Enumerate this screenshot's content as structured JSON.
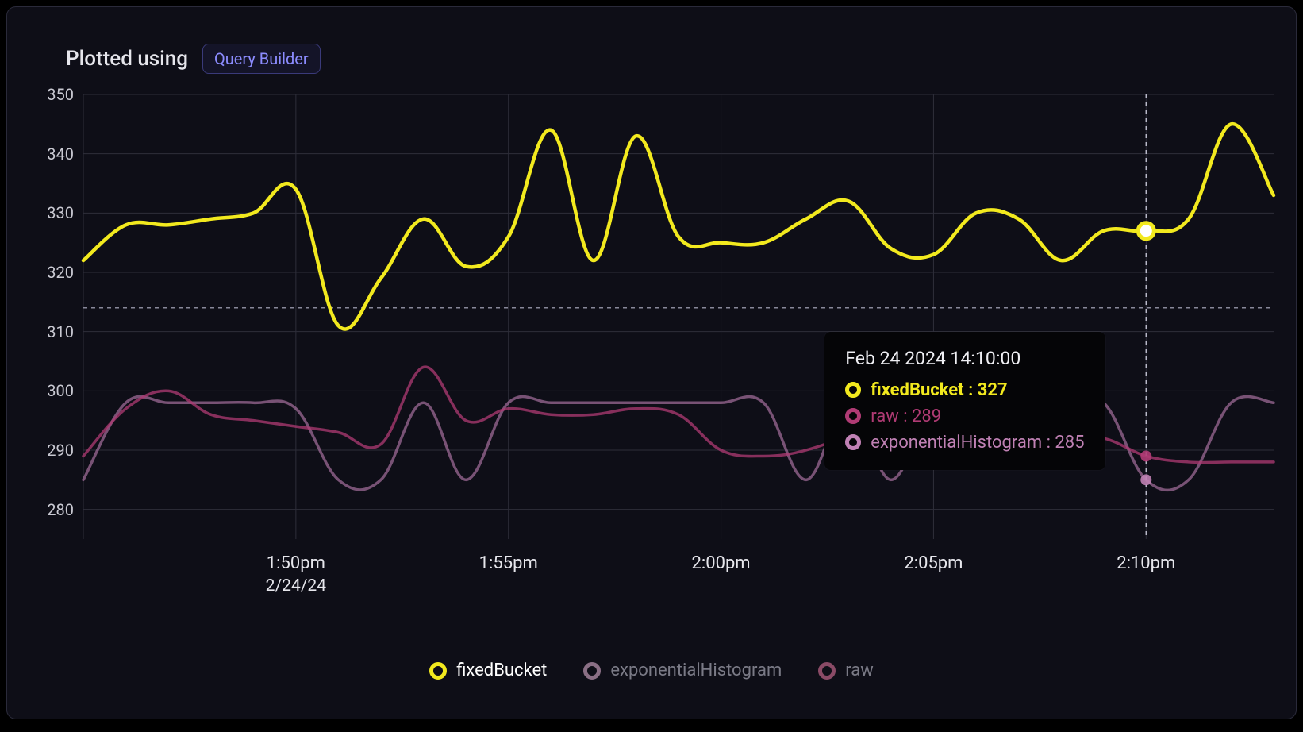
{
  "header": {
    "title": "Plotted using",
    "badge": "Query Builder"
  },
  "chart_data": {
    "type": "line",
    "ylim": [
      275,
      350
    ],
    "y_ticks": [
      280,
      290,
      300,
      310,
      320,
      330,
      340,
      350
    ],
    "x_ticks": [
      {
        "label": "1:50pm",
        "sub": "2/24/24",
        "idx": 5
      },
      {
        "label": "1:55pm",
        "sub": "",
        "idx": 10
      },
      {
        "label": "2:00pm",
        "sub": "",
        "idx": 15
      },
      {
        "label": "2:05pm",
        "sub": "",
        "idx": 20
      },
      {
        "label": "2:10pm",
        "sub": "",
        "idx": 25
      }
    ],
    "reference_line": 314,
    "hover_idx": 25,
    "series": [
      {
        "name": "fixedBucket",
        "color": "#f2e91e",
        "width": 4.5,
        "opacity": 1,
        "values": [
          322,
          328,
          328,
          329,
          330,
          334,
          311,
          319,
          329,
          321,
          326,
          344,
          322,
          343,
          326,
          325,
          325,
          329,
          332,
          324,
          323,
          330,
          329,
          322,
          327,
          327,
          329,
          345,
          333
        ]
      },
      {
        "name": "exponentialHistogram",
        "color": "#c081b4",
        "width": 3.5,
        "opacity": 0.6,
        "values": [
          285,
          298,
          298,
          298,
          298,
          297,
          285,
          285,
          298,
          285,
          298,
          298,
          298,
          298,
          298,
          298,
          298,
          285,
          298,
          285,
          298,
          298,
          298,
          298,
          298,
          285,
          285,
          298,
          298
        ]
      },
      {
        "name": "raw",
        "color": "#b03b74",
        "width": 3.5,
        "opacity": 0.75,
        "values": [
          289,
          297,
          300,
          296,
          295,
          294,
          293,
          291,
          304,
          295,
          297,
          296,
          296,
          297,
          296,
          290,
          289,
          290,
          293,
          299,
          295,
          294,
          293,
          292,
          292,
          289,
          288,
          288,
          288
        ]
      }
    ]
  },
  "tooltip": {
    "timestamp": "Feb 24 2024 14:10:00",
    "rows": [
      {
        "label": "fixedBucket : 327",
        "color": "#f2e91e",
        "bold": true
      },
      {
        "label": "raw : 289",
        "color": "#b03b74",
        "bold": false
      },
      {
        "label": "exponentialHistogram : 285",
        "color": "#c081b4",
        "bold": false
      }
    ]
  },
  "legend": [
    {
      "label": "fixedBucket",
      "color": "#f2e91e",
      "text_color": "#ffffff"
    },
    {
      "label": "exponentialHistogram",
      "color": "#8a6f85",
      "text_color": "#7a7a86"
    },
    {
      "label": "raw",
      "color": "#8a4a66",
      "text_color": "#7a7a86"
    }
  ]
}
